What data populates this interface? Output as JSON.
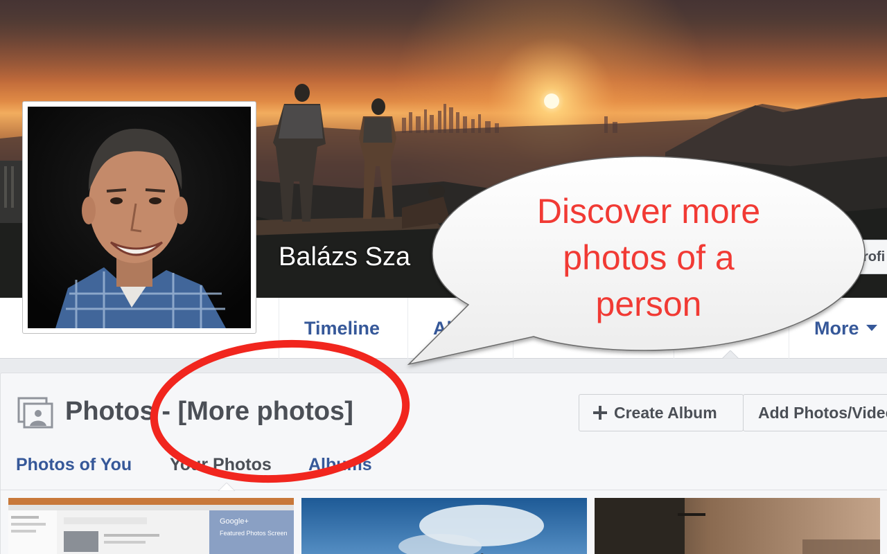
{
  "profile": {
    "name": "Balázs Szabó",
    "name_visible": "Balázs Sza",
    "profile_button_label": "rofi"
  },
  "nav": {
    "timeline": "Timeline",
    "about": "About",
    "more": "More"
  },
  "photos": {
    "title": "Photos",
    "title_suffix": "- [More photos]",
    "create_album": "Create Album",
    "add_photos": "Add Photos/Video",
    "tabs": [
      "Photos of You",
      "Your Photos",
      "Albums"
    ],
    "active_tab": "Your Photos"
  },
  "thumbnails": {
    "first_caption_brand": "Google+",
    "first_caption_line": "Featured Photos Screen"
  },
  "annotation": {
    "bubble_lines": [
      "Discover more",
      "photos of a",
      "person"
    ],
    "bubble_color": "#f13a34",
    "circle_color": "#f1261e"
  },
  "colors": {
    "link": "#365899",
    "text_dark": "#4b4f56",
    "page_bg": "#e9ebee"
  }
}
